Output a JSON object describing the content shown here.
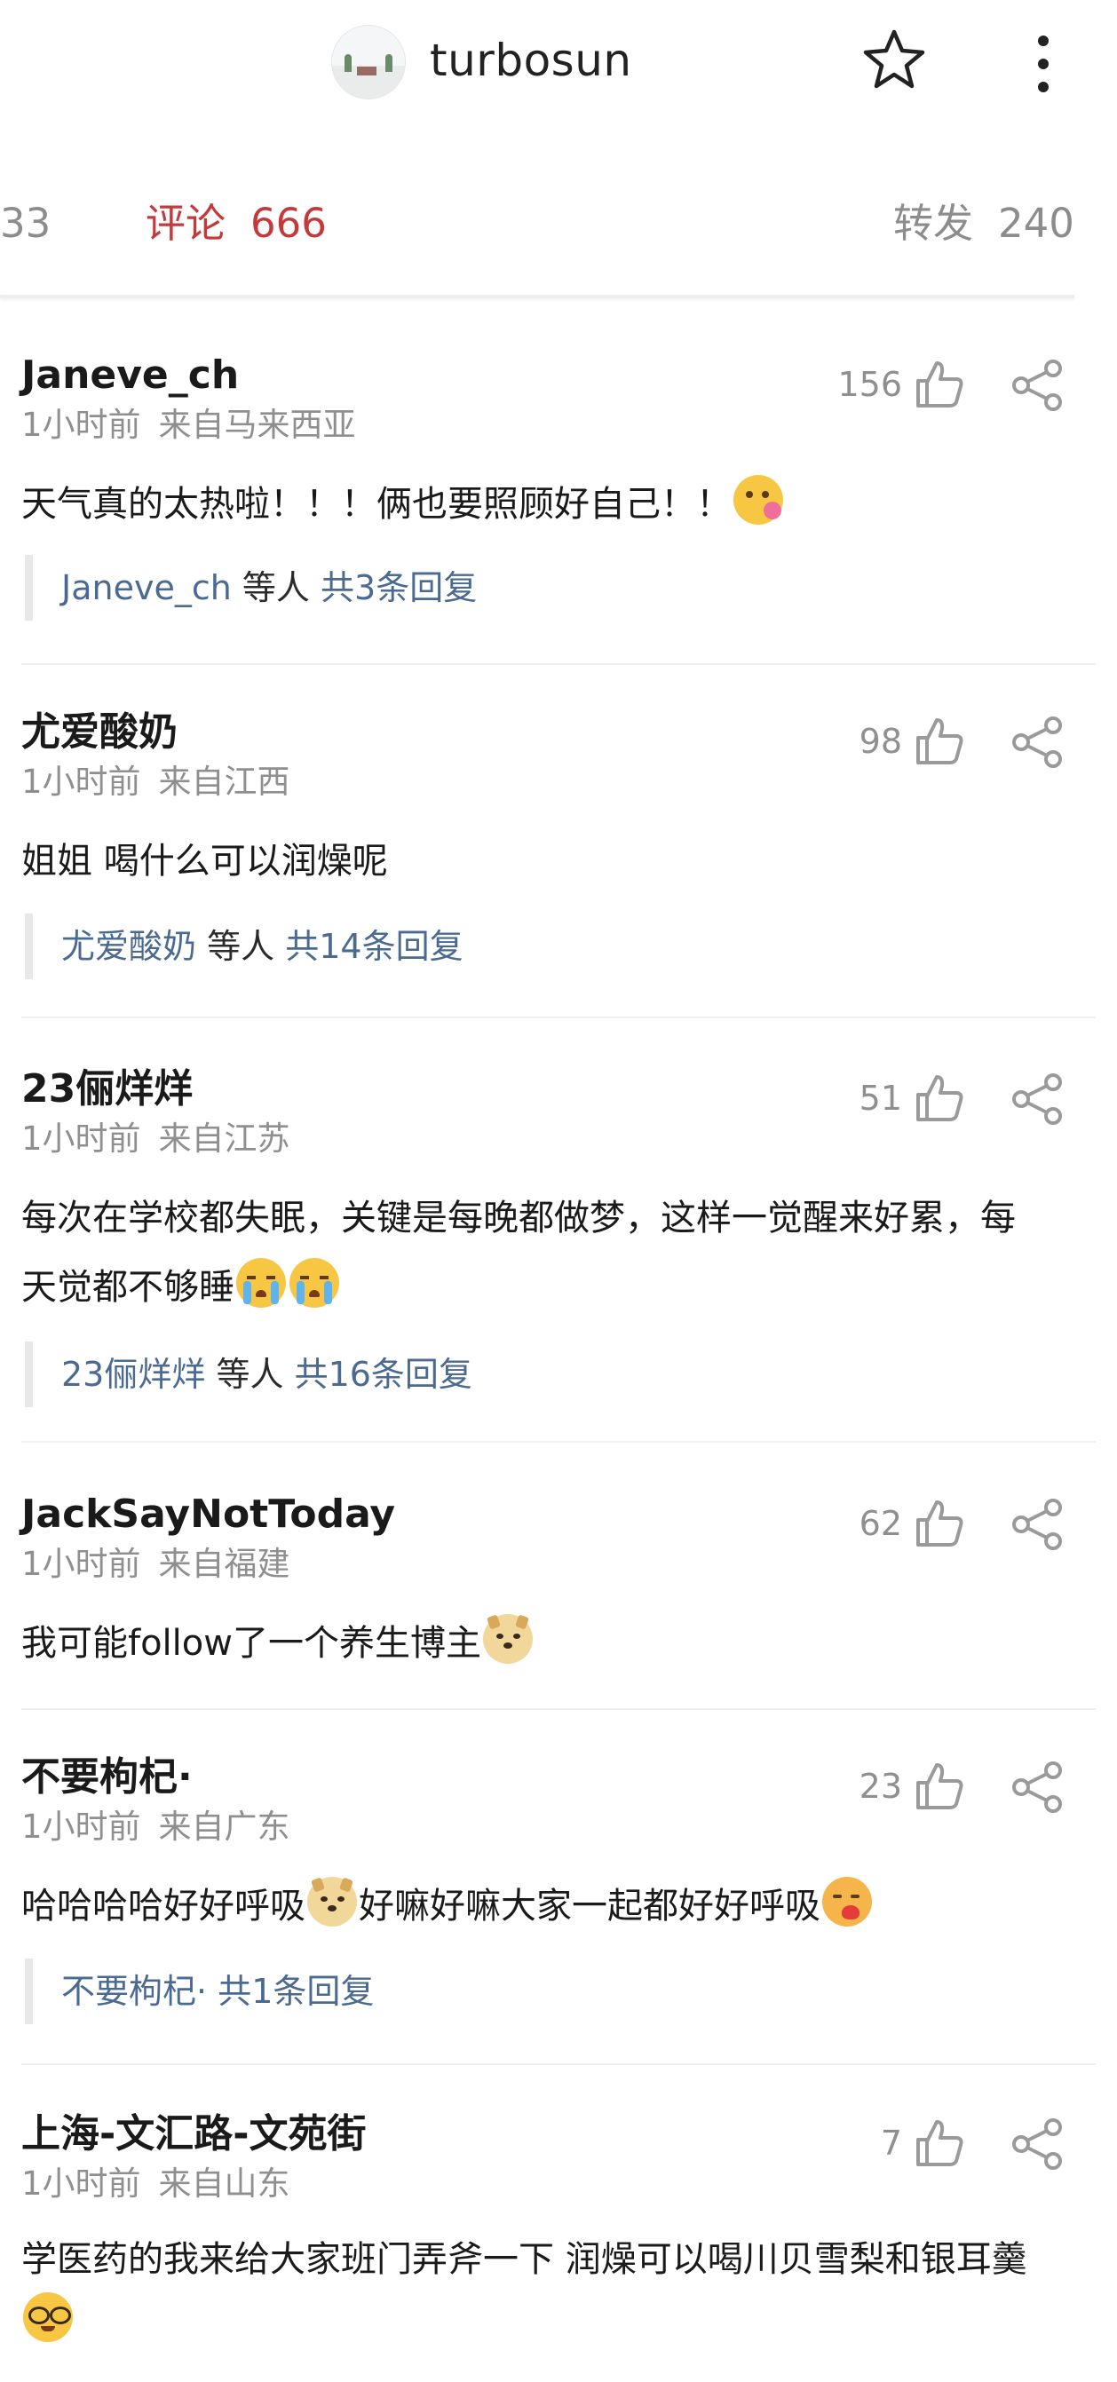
{
  "header": {
    "title": "turbosun",
    "star_icon": "star-icon",
    "more_icon": "more-vertical-icon"
  },
  "tabs": [
    {
      "label": "",
      "count": "33"
    },
    {
      "label": "评论",
      "count": "666"
    },
    {
      "label": "转发",
      "count": "240"
    }
  ],
  "colors": {
    "accent": "#c43a3a",
    "link": "#4a6a92",
    "muted": "#8f8f8f"
  },
  "comments": [
    {
      "user": "Janeve_ch",
      "time": "1小时前",
      "source": "来自马来西亚",
      "text": "天气真的太热啦！！！俩也要照顾好自己！！",
      "emojis": [
        "flower-emoji"
      ],
      "likes": "156",
      "reply_user": "Janeve_ch",
      "reply_mid": "等人",
      "reply_total": "共3条回复"
    },
    {
      "user": "尤爱酸奶",
      "time": "1小时前",
      "source": "来自江西",
      "text": "姐姐 喝什么可以润燥呢",
      "likes": "98",
      "reply_user": "尤爱酸奶",
      "reply_mid": "等人",
      "reply_total": "共14条回复"
    },
    {
      "user": "23俪烊烊",
      "time": "1小时前",
      "source": "来自江苏",
      "text_line1": "每次在学校都失眠，关键是每晚都做梦，这样一觉醒来好累，每",
      "text_line2": "天觉都不够睡",
      "emojis": [
        "crying-emoji",
        "crying-emoji"
      ],
      "likes": "51",
      "reply_user": "23俪烊烊",
      "reply_mid": "等人",
      "reply_total": "共16条回复"
    },
    {
      "user": "JackSayNotToday",
      "time": "1小时前",
      "source": "来自福建",
      "text": "我可能follow了一个养生博主",
      "emojis": [
        "doge-emoji"
      ],
      "likes": "62"
    },
    {
      "user": "不要枸杞·",
      "time": "1小时前",
      "source": "来自广东",
      "text_part1": "哈哈哈哈好好呼吸",
      "text_part2": "好嘛好嘛大家一起都好好呼吸",
      "emojis": [
        "doge-emoji",
        "heart-kiss-emoji"
      ],
      "likes": "23",
      "reply_user": "不要枸杞·",
      "reply_mid": "",
      "reply_total": "共1条回复"
    },
    {
      "user": "上海-文汇路-文苑街",
      "time": "1小时前",
      "source": "来自山东",
      "text": "学医药的我来给大家班门弄斧一下 润燥可以喝川贝雪梨和银耳羹",
      "emojis": [
        "nerd-emoji"
      ],
      "likes": "7"
    }
  ]
}
